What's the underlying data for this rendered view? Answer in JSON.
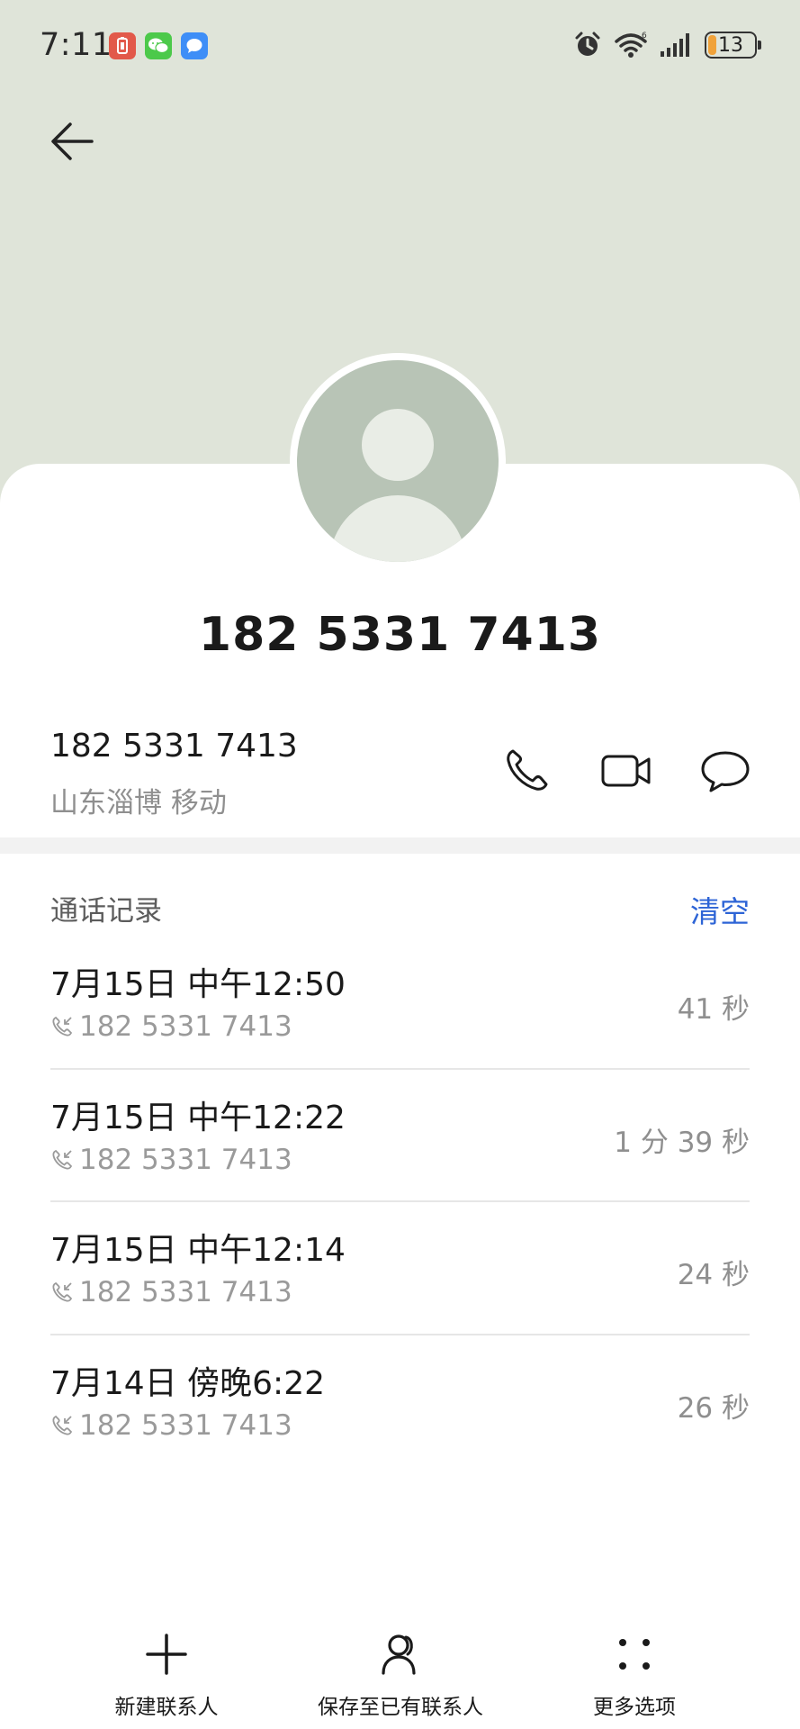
{
  "status_bar": {
    "time": "7:11",
    "battery": "13",
    "icons": [
      "battery-saver-icon",
      "wechat-icon",
      "message-icon",
      "alarm-icon",
      "wifi-icon",
      "signal-icon"
    ]
  },
  "contact": {
    "display_number": "182 5331 7413",
    "number": "182 5331 7413",
    "location": "山东淄博 移动"
  },
  "call_log": {
    "header": "通话记录",
    "clear_label": "清空",
    "items": [
      {
        "time": "7月15日 中午12:50",
        "number": "182 5331 7413",
        "duration": "41 秒"
      },
      {
        "time": "7月15日 中午12:22",
        "number": "182 5331 7413",
        "duration": "1 分 39 秒"
      },
      {
        "time": "7月15日 中午12:14",
        "number": "182 5331 7413",
        "duration": "24 秒"
      },
      {
        "time": "7月14日 傍晚6:22",
        "number": "182 5331 7413",
        "duration": "26 秒"
      }
    ]
  },
  "bottom_bar": {
    "new_contact": "新建联系人",
    "save_existing": "保存至已有联系人",
    "more_options": "更多选项"
  },
  "colors": {
    "header_bg": "#dfe4d9",
    "accent": "#2d64d6"
  }
}
